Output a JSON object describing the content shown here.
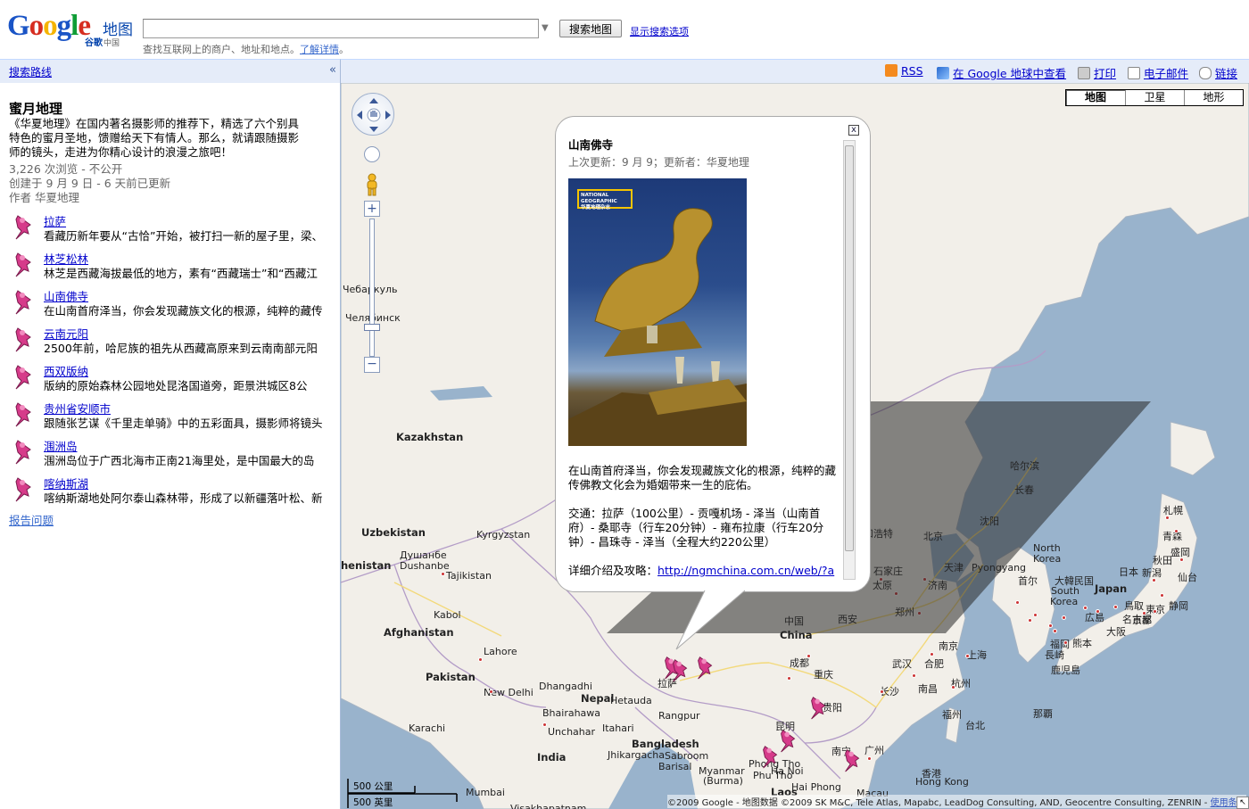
{
  "header": {
    "logo_text": "Google",
    "logo_maps": "地图",
    "logo_gugou": "谷歌",
    "logo_region": "中国",
    "search_placeholder": "",
    "search_button": "搜索地图",
    "show_options": "显示搜索选项",
    "hint_text": "查找互联网上的商户、地址和地点。",
    "hint_link": "了解详情",
    "hint_end": "。"
  },
  "left": {
    "directions": "搜索路线",
    "collapse": "«",
    "title": "蜜月地理",
    "description": "《华夏地理》在国内著名摄影师的推荐下，精选了六个别具特色的蜜月圣地，馈赠给天下有情人。那么，就请跟随摄影师的镜头，走进为你精心设计的浪漫之旅吧！",
    "views": "3,226 次浏览 - 不公开",
    "created": "创建于 9 月 9 日 - 6 天前已更新",
    "author_prefix": "作者",
    "author": "华夏地理",
    "items": [
      {
        "title": "拉萨",
        "desc": "看藏历新年要从“古恰”开始，被打扫一新的屋子里，梁、"
      },
      {
        "title": "林芝松林",
        "desc": "林芝是西藏海拔最低的地方，素有“西藏瑞士”和“西藏江"
      },
      {
        "title": "山南佛寺",
        "desc": "在山南首府泽当，你会发现藏族文化的根源，纯粹的藏传"
      },
      {
        "title": "云南元阳",
        "desc": "2500年前，哈尼族的祖先从西藏高原来到云南南部元阳"
      },
      {
        "title": "西双版纳",
        "desc": "版纳的原始森林公园地处昆洛国道旁，距景洪城区8公"
      },
      {
        "title": "贵州省安顺市",
        "desc": "跟随张艺谋《千里走单骑》中的五彩面具，摄影师将镜头"
      },
      {
        "title": "涠洲岛",
        "desc": "涠洲岛位于广西北海市正南21海里处，是中国最大的岛"
      },
      {
        "title": "喀纳斯湖",
        "desc": "喀纳斯湖地处阿尔泰山森林带，形成了以新疆落叶松、新"
      }
    ],
    "report": "报告问题"
  },
  "map_toolbar": {
    "rss": "RSS",
    "earth": "在 Google 地球中查看",
    "print": "打印",
    "email": "电子邮件",
    "link": "链接"
  },
  "map_types": [
    "地图",
    "卫星",
    "地形"
  ],
  "colors": {
    "toolbar_bg": "#e5ecf9",
    "link": "#0000cc",
    "pin": "#d63b8a",
    "water": "#99b3cc",
    "land": "#f2efe9"
  },
  "map_labels": [
    {
      "text": "Kazakhstan",
      "bold": true
    },
    {
      "text": "Uzbekistan",
      "bold": true
    },
    {
      "text": "Kyrgyzstan"
    },
    {
      "text": "Душанбе"
    },
    {
      "text": "Dushanbe"
    },
    {
      "text": "Tajikistan"
    },
    {
      "text": "henistan",
      "bold": true
    },
    {
      "text": "Kabol"
    },
    {
      "text": "Afghanistan",
      "bold": true
    },
    {
      "text": "Lahore"
    },
    {
      "text": "Pakistan",
      "bold": true
    },
    {
      "text": "New Delhi"
    },
    {
      "text": "Nepal",
      "bold": true
    },
    {
      "text": "Dhangadhi"
    },
    {
      "text": "Hetauda"
    },
    {
      "text": "Bhairahawa"
    },
    {
      "text": "Rangpur"
    },
    {
      "text": "Itahari"
    },
    {
      "text": "Unchahar"
    },
    {
      "text": "Bangladesh",
      "bold": true
    },
    {
      "text": "Jhikargacha"
    },
    {
      "text": "Barisal"
    },
    {
      "text": "Sabroom"
    },
    {
      "text": "India",
      "bold": true
    },
    {
      "text": "Karachi"
    },
    {
      "text": "Mumbai"
    },
    {
      "text": "Visakhapatnam"
    },
    {
      "text": "Myanmar"
    },
    {
      "text": "(Burma)"
    },
    {
      "text": "Laos",
      "bold": true
    },
    {
      "text": "Phong Tho"
    },
    {
      "text": "Phu Tho"
    },
    {
      "text": "Ha Noi"
    },
    {
      "text": "Hai Phong"
    },
    {
      "text": "中国"
    },
    {
      "text": "China",
      "bold": true
    },
    {
      "text": "拉萨"
    },
    {
      "text": "成都"
    },
    {
      "text": "重庆"
    },
    {
      "text": "昆明"
    },
    {
      "text": "贵阳"
    },
    {
      "text": "南宁"
    },
    {
      "text": "广州"
    },
    {
      "text": "香港"
    },
    {
      "text": "Hong Kong"
    },
    {
      "text": "Macau"
    },
    {
      "text": "西安"
    },
    {
      "text": "太原"
    },
    {
      "text": "石家庄"
    },
    {
      "text": "济南"
    },
    {
      "text": "郑州"
    },
    {
      "text": "北京"
    },
    {
      "text": "天津"
    },
    {
      "text": "呼和浩特"
    },
    {
      "text": "沈阳"
    },
    {
      "text": "长春"
    },
    {
      "text": "哈尔滨"
    },
    {
      "text": "武汉"
    },
    {
      "text": "合肥"
    },
    {
      "text": "南京"
    },
    {
      "text": "上海"
    },
    {
      "text": "杭州"
    },
    {
      "text": "长沙"
    },
    {
      "text": "南昌"
    },
    {
      "text": "福州"
    },
    {
      "text": "台北"
    },
    {
      "text": "那覇"
    },
    {
      "text": "Pyongyang"
    },
    {
      "text": "North"
    },
    {
      "text": "Korea"
    },
    {
      "text": "首尔"
    },
    {
      "text": "South"
    },
    {
      "text": "Korea"
    },
    {
      "text": "大韓民国"
    },
    {
      "text": "Japan",
      "bold": true
    },
    {
      "text": "日本"
    },
    {
      "text": "札幌"
    },
    {
      "text": "青森"
    },
    {
      "text": "盛岡"
    },
    {
      "text": "秋田"
    },
    {
      "text": "仙台"
    },
    {
      "text": "新潟"
    },
    {
      "text": "東京"
    },
    {
      "text": "名古屋"
    },
    {
      "text": "大阪"
    },
    {
      "text": "京都"
    },
    {
      "text": "広島"
    },
    {
      "text": "福岡"
    },
    {
      "text": "熊本"
    },
    {
      "text": "長崎"
    },
    {
      "text": "鹿児島"
    },
    {
      "text": "静岡"
    },
    {
      "text": "鳥取"
    },
    {
      "text": "Чебаркуль"
    },
    {
      "text": "Челябинск"
    }
  ],
  "info_window": {
    "title": "山南佛寺",
    "updated": "上次更新：9 月 9；更新者：华夏地理",
    "photo_brand": "NATIONAL GEOGRAPHIC",
    "photo_brand_cn": "华夏地理杂志",
    "paragraph1": "在山南首府泽当，你会发现藏族文化的根源，纯粹的藏传佛教文化会为婚姻带来一生的庇佑。",
    "paragraph2": "交通：拉萨（100公里）- 贡嘎机场 - 泽当（山南首府）- 桑耶寺（行车20分钟）- 雍布拉康（行车20分钟）- 昌珠寺 - 泽当（全程大约220公里）",
    "detail_label": "详细介绍及攻略：",
    "detail_link": "http://ngmchina.com.cn/web/?action-viewnews-itemid-157017",
    "close": "x"
  },
  "scale": {
    "metric": "500 公里",
    "imperial": "500 英里"
  },
  "attribution": "©2009 Google - 地图数据 ©2009 SK M&C, Tele Atlas, Mapabc, LeadDog Consulting, AND, Geocentre Consulting, ZENRIN - ",
  "terms": "使用条款"
}
